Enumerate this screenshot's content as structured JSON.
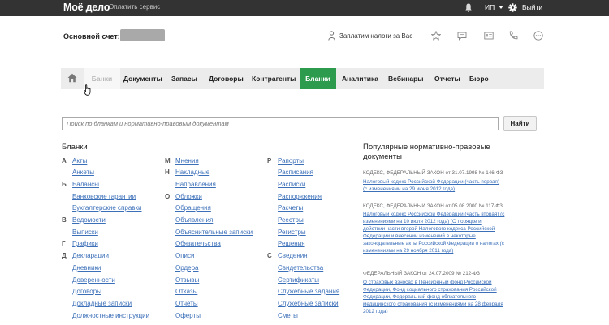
{
  "topbar": {
    "logo": "Моё дело",
    "pay_link": "Оплатить сервис",
    "user": "ИП",
    "logout": "Выйти"
  },
  "account": {
    "label": "Основной счет:",
    "tax_link": "Заплатим налоги за Вас"
  },
  "nav": {
    "tabs": [
      {
        "label": "Банки"
      },
      {
        "label": "Документы"
      },
      {
        "label": "Запасы"
      },
      {
        "label": "Договоры"
      },
      {
        "label": "Контрагенты"
      },
      {
        "label": "Бланки"
      },
      {
        "label": "Аналитика"
      },
      {
        "label": "Вебинары"
      },
      {
        "label": "Отчеты"
      },
      {
        "label": "Бюро"
      }
    ]
  },
  "search": {
    "placeholder": "Поиск по бланкам и нормативно-правовым документам",
    "button": "Найти"
  },
  "blanki": {
    "title": "Бланки",
    "col1_letters": [
      "А",
      "Б",
      "В",
      "Г",
      "Д"
    ],
    "col1_links": [
      "Акты",
      "Анкеты",
      "Балансы",
      "Банковские гарантии",
      "Бухгалтерские справки",
      "Ведомости",
      "Выписки",
      "Графики",
      "Декларации",
      "Дневники",
      "Доверенности",
      "Договоры",
      "Докладные записки",
      "Должностные инструкции"
    ],
    "col2_letters": [
      "М",
      "Н",
      "О"
    ],
    "col2_links": [
      "Мнения",
      "Накладные",
      "Направления",
      "Обложки",
      "Обращения",
      "Объявления",
      "Объяснительные записки",
      "Обязательства",
      "Описи",
      "Ордера",
      "Отзывы",
      "Отказы",
      "Отчеты",
      "Оферты"
    ],
    "col3_letters": [
      "Р",
      "С"
    ],
    "col3_links": [
      "Рапорты",
      "Расписания",
      "Расписки",
      "Распоряжения",
      "Расчеты",
      "Реестры",
      "Регистры",
      "Решения",
      "Сведения",
      "Свидетельства",
      "Сертификаты",
      "Служебные задания",
      "Служебные записки",
      "Сметы"
    ]
  },
  "popular": {
    "title": "Популярные нормативно-правовые документы",
    "docs": [
      {
        "head": "КОДЕКС, ФЕДЕРАЛЬНЫЙ ЗАКОН от 31.07.1998 № 146-ФЗ",
        "lines": [
          "Налоговый кодекс Российской Федерации (часть первая)",
          "(с изменениями на 29 июня 2012 года)"
        ]
      },
      {
        "head": "КОДЕКС, ФЕДЕРАЛЬНЫЙ ЗАКОН от 05.08.2000 № 117-ФЗ",
        "lines": [
          "Налоговый кодекс Российской Федерации (часть вторая) (с",
          "изменениями на 10 июля 2012 года) (О порядке и",
          "действии части второй Налогового кодекса Российской",
          "Федерации и внесении изменений в некоторые",
          "законодательные акты Российской Федерации о налогах (с",
          "изменениями на 29 ноября 2011 года)"
        ]
      },
      {
        "head": "ФЕДЕРАЛЬНЫЙ ЗАКОН от 24.07.2009 № 212-ФЗ",
        "lines": [
          "О страховых взносах в Пенсионный фонд Российской",
          "Федерации, Фонд социального страхования Российской",
          "Федерации, Федеральный фонд обязательного",
          "медицинского страхования (с изменениями на 28 февраля",
          "2012 года)"
        ]
      }
    ]
  },
  "colors": {
    "topbar": "#333333",
    "active_tab": "#2c9b4e",
    "link": "#3b6fb8"
  }
}
